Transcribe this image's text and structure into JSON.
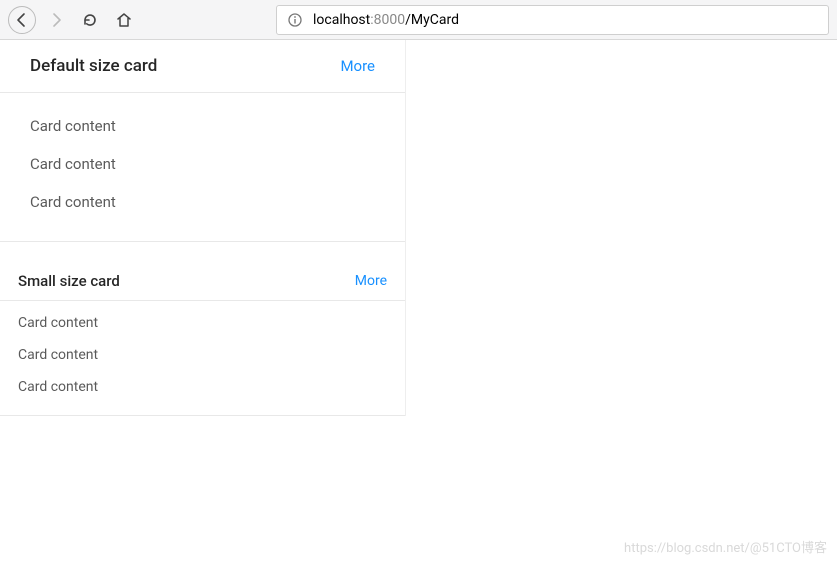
{
  "browser": {
    "url_host": "localhost",
    "url_port": ":8000",
    "url_path": "/MyCard"
  },
  "cards": {
    "default": {
      "title": "Default size card",
      "extra": "More",
      "content": [
        "Card content",
        "Card content",
        "Card content"
      ]
    },
    "small": {
      "title": "Small size card",
      "extra": "More",
      "content": [
        "Card content",
        "Card content",
        "Card content"
      ]
    }
  },
  "watermark": "https://blog.csdn.net/@51CTO博客"
}
